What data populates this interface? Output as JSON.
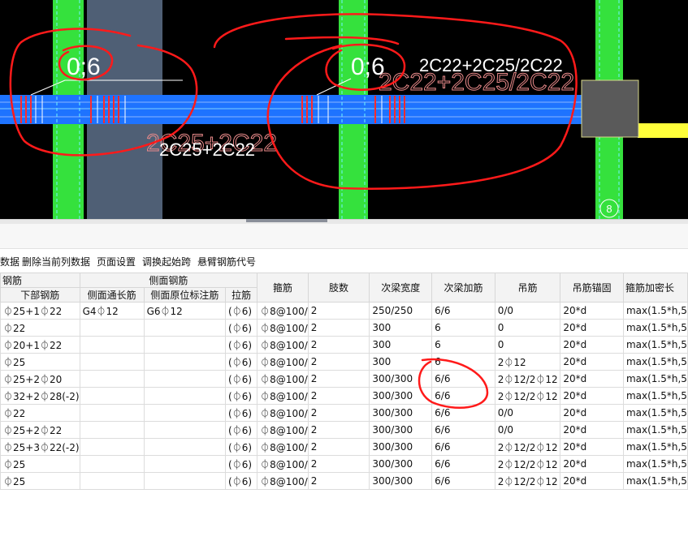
{
  "drawing": {
    "left_label": "0;6",
    "mid_label": "0;6",
    "top_rebar": "2C22+2C25/2C22",
    "top_rebar_ghost": "2C22+2C25/2C22",
    "bottom_rebar": "2C25+2C22",
    "bottom_rebar_ghost": "2C25+2C22",
    "axis_number": "8",
    "colors": {
      "beam": "#1e73ff",
      "column": "#35e13d",
      "annotation": "#ff1a1a",
      "background": "#000000",
      "pink_text": "#e98a8a"
    }
  },
  "toolbar": {
    "items": [
      "数据",
      "删除当前列数据",
      "页面设置",
      "调换起始跨",
      "悬臂钢筋代号"
    ]
  },
  "table": {
    "group_headers": {
      "rebar": "钢筋",
      "side": "侧面钢筋"
    },
    "headers": [
      "下部钢筋",
      "侧面通长筋",
      "侧面原位标注筋",
      "拉筋",
      "箍筋",
      "肢数",
      "次梁宽度",
      "次梁加筋",
      "吊筋",
      "吊筋锚固",
      "箍筋加密长"
    ],
    "rows": [
      [
        "⏀25+1⏀22",
        "G4⏀12",
        "G6⏀12",
        "(⏀6)",
        "⏀8@100/",
        "2",
        "250/250",
        "6/6",
        "0/0",
        "20*d",
        "max(1.5*h,5"
      ],
      [
        "⏀22",
        "",
        "",
        "(⏀6)",
        "⏀8@100/",
        "2",
        "300",
        "6",
        "0",
        "20*d",
        "max(1.5*h,5"
      ],
      [
        "⏀20+1⏀22",
        "",
        "",
        "(⏀6)",
        "⏀8@100/",
        "2",
        "300",
        "6",
        "0",
        "20*d",
        "max(1.5*h,5"
      ],
      [
        "⏀25",
        "",
        "",
        "(⏀6)",
        "⏀8@100/",
        "2",
        "300",
        "6",
        "2⏀12",
        "20*d",
        "max(1.5*h,5"
      ],
      [
        "⏀25+2⏀20",
        "",
        "",
        "(⏀6)",
        "⏀8@100/",
        "2",
        "300/300",
        "6/6",
        "2⏀12/2⏀12",
        "20*d",
        "max(1.5*h,5"
      ],
      [
        "⏀32+2⏀28(-2)",
        "",
        "",
        "(⏀6)",
        "⏀8@100/",
        "2",
        "300/300",
        "6/6",
        "2⏀12/2⏀12",
        "20*d",
        "max(1.5*h,5"
      ],
      [
        "⏀22",
        "",
        "",
        "(⏀6)",
        "⏀8@100/",
        "2",
        "300/300",
        "6/6",
        "0/0",
        "20*d",
        "max(1.5*h,5"
      ],
      [
        "⏀25+2⏀22",
        "",
        "",
        "(⏀6)",
        "⏀8@100/",
        "2",
        "300/300",
        "6/6",
        "0/0",
        "20*d",
        "max(1.5*h,5"
      ],
      [
        "⏀25+3⏀22(-2)",
        "",
        "",
        "(⏀6)",
        "⏀8@100/",
        "2",
        "300/300",
        "6/6",
        "2⏀12/2⏀12",
        "20*d",
        "max(1.5*h,5"
      ],
      [
        "⏀25",
        "",
        "",
        "(⏀6)",
        "⏀8@100/",
        "2",
        "300/300",
        "6/6",
        "2⏀12/2⏀12",
        "20*d",
        "max(1.5*h,5"
      ],
      [
        "⏀25",
        "",
        "",
        "(⏀6)",
        "⏀8@100/",
        "2",
        "300/300",
        "6/6",
        "2⏀12/2⏀12",
        "20*d",
        "max(1.5*h,5"
      ]
    ]
  }
}
